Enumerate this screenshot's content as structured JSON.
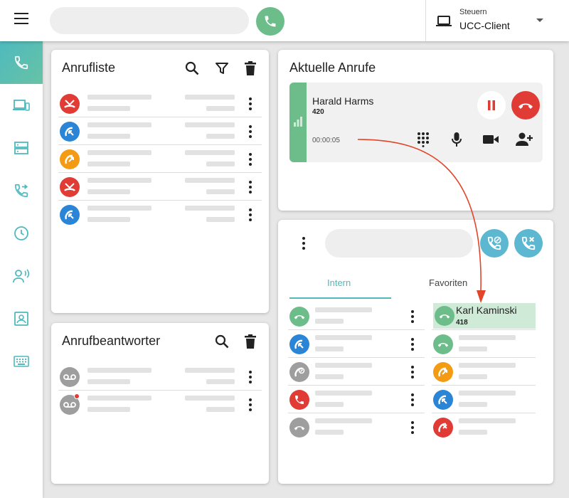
{
  "topbar": {
    "control_label": "Steuern",
    "control_value": "UCC-Client",
    "search_placeholder": ""
  },
  "sidebar": {
    "items": [
      {
        "icon": "phone-icon",
        "active": true
      },
      {
        "icon": "devices-icon",
        "active": false
      },
      {
        "icon": "server-icon",
        "active": false
      },
      {
        "icon": "call-forward-icon",
        "active": false
      },
      {
        "icon": "clock-icon",
        "active": false
      },
      {
        "icon": "voice-icon",
        "active": false
      },
      {
        "icon": "contact-card-icon",
        "active": false
      },
      {
        "icon": "keyboard-icon",
        "active": false
      }
    ]
  },
  "call_list": {
    "title": "Anrufliste",
    "items": [
      {
        "type": "missed",
        "color": "#e03b35"
      },
      {
        "type": "incoming",
        "color": "#2a85d6"
      },
      {
        "type": "outgoing",
        "color": "#f39b12"
      },
      {
        "type": "missed",
        "color": "#e03b35"
      },
      {
        "type": "incoming",
        "color": "#2a85d6"
      }
    ]
  },
  "voicemail": {
    "title": "Anrufbeantworter",
    "items": [
      {
        "type": "voicemail",
        "unread": false
      },
      {
        "type": "voicemail",
        "unread": true
      }
    ]
  },
  "current_calls": {
    "title": "Aktuelle Anrufe",
    "call": {
      "name": "Harald Harms",
      "number": "420",
      "duration": "00:00:05"
    }
  },
  "contacts": {
    "search_placeholder": "",
    "tabs": [
      {
        "label": "Intern",
        "active": true
      },
      {
        "label": "Favoriten",
        "active": false
      }
    ],
    "intern": [
      {
        "state": "idle",
        "color": "#6cbd8a"
      },
      {
        "state": "incoming",
        "color": "#2a85d6"
      },
      {
        "state": "dnd",
        "color": "#9e9e9e"
      },
      {
        "state": "busy",
        "color": "#e03b35"
      },
      {
        "state": "offline",
        "color": "#9e9e9e"
      }
    ],
    "favorites": [
      {
        "state": "idle",
        "color": "#6cbd8a",
        "name": "Karl Kaminski",
        "number": "418",
        "highlighted": true
      },
      {
        "state": "idle",
        "color": "#6cbd8a"
      },
      {
        "state": "outgoing",
        "color": "#f39b12"
      },
      {
        "state": "incoming",
        "color": "#2a85d6"
      },
      {
        "state": "blocked",
        "color": "#e03b35"
      }
    ]
  },
  "colors": {
    "accent": "#4fb9be",
    "green": "#6cbd8a",
    "red": "#e03b35",
    "blue": "#2a85d6",
    "orange": "#f39b12",
    "gray": "#9e9e9e",
    "arrow": "#e2452a"
  }
}
